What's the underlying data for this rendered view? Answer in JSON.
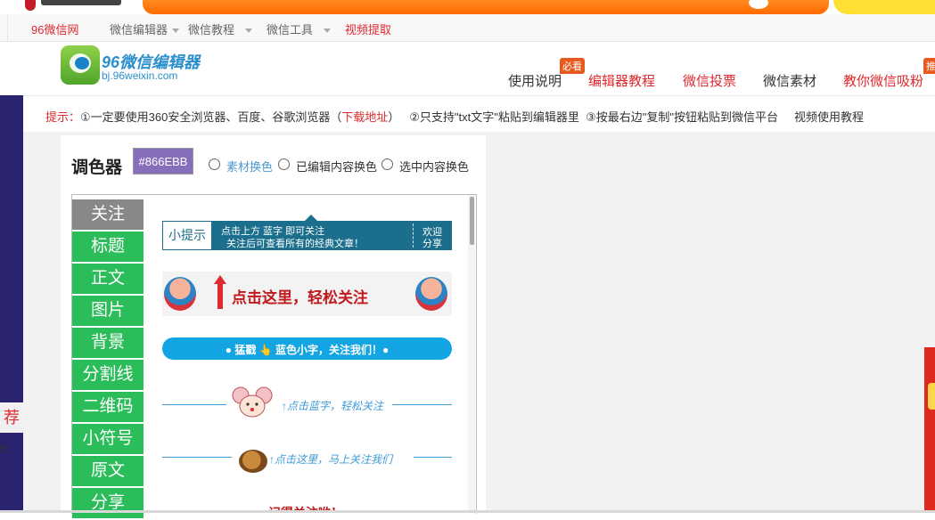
{
  "topnav": {
    "site": "96微信网",
    "editor": "微信编辑器",
    "tutorial": "微信教程",
    "tools": "微信工具",
    "video": "视频提取"
  },
  "logo": {
    "title": "96微信编辑器",
    "url": "bj.96weixin.com"
  },
  "mainnav": {
    "items": [
      {
        "label": "使用说明"
      },
      {
        "label": "编辑器教程",
        "badge": "必看"
      },
      {
        "label": "微信投票"
      },
      {
        "label": "微信素材"
      },
      {
        "label": "教你微信吸粉",
        "badge": "推"
      }
    ]
  },
  "tip": {
    "prefix": "提示：",
    "t1": "①一定要使用360安全浏览器、百度、谷歌浏览器（",
    "download": "下载地址",
    "t2": "）",
    "t3": "②只支持\"txt文字\"粘贴到编辑器里",
    "t4": "③按最右边\"复制\"按钮粘贴到微信平台",
    "video": "视频使用教程"
  },
  "sidebar": {
    "tag": "荐",
    "small": "告"
  },
  "colorpicker": {
    "label": "调色器",
    "value": "#866EBB",
    "options": [
      "素材换色",
      "已编辑内容换色",
      "选中内容换色"
    ]
  },
  "categories": [
    "关注",
    "标题",
    "正文",
    "图片",
    "背景",
    "分割线",
    "二维码",
    "小符号",
    "原文",
    "分享"
  ],
  "materials": {
    "m1": {
      "tip": "小提示",
      "line1": "点击上方 蓝字 即可关注",
      "line2": "关注后可查看所有的经典文章！",
      "w1": "欢迎",
      "w2": "分享"
    },
    "m2": {
      "text": "点击这里，轻松关注"
    },
    "m3": {
      "text": "● 猛戳 👆 蓝色小字，关注我们！●"
    },
    "m4": {
      "text": "↑点击蓝字，轻松关注"
    },
    "m5": {
      "text": "↑点击这里，马上关注我们"
    },
    "m6": {
      "text": "↑记得关注哟！"
    }
  },
  "colors": {
    "accent_green": "#2bbd59",
    "active_gray": "#888888",
    "swatch": "#866EBB",
    "brand_blue": "#2a8fcc",
    "red": "#e0292e"
  }
}
